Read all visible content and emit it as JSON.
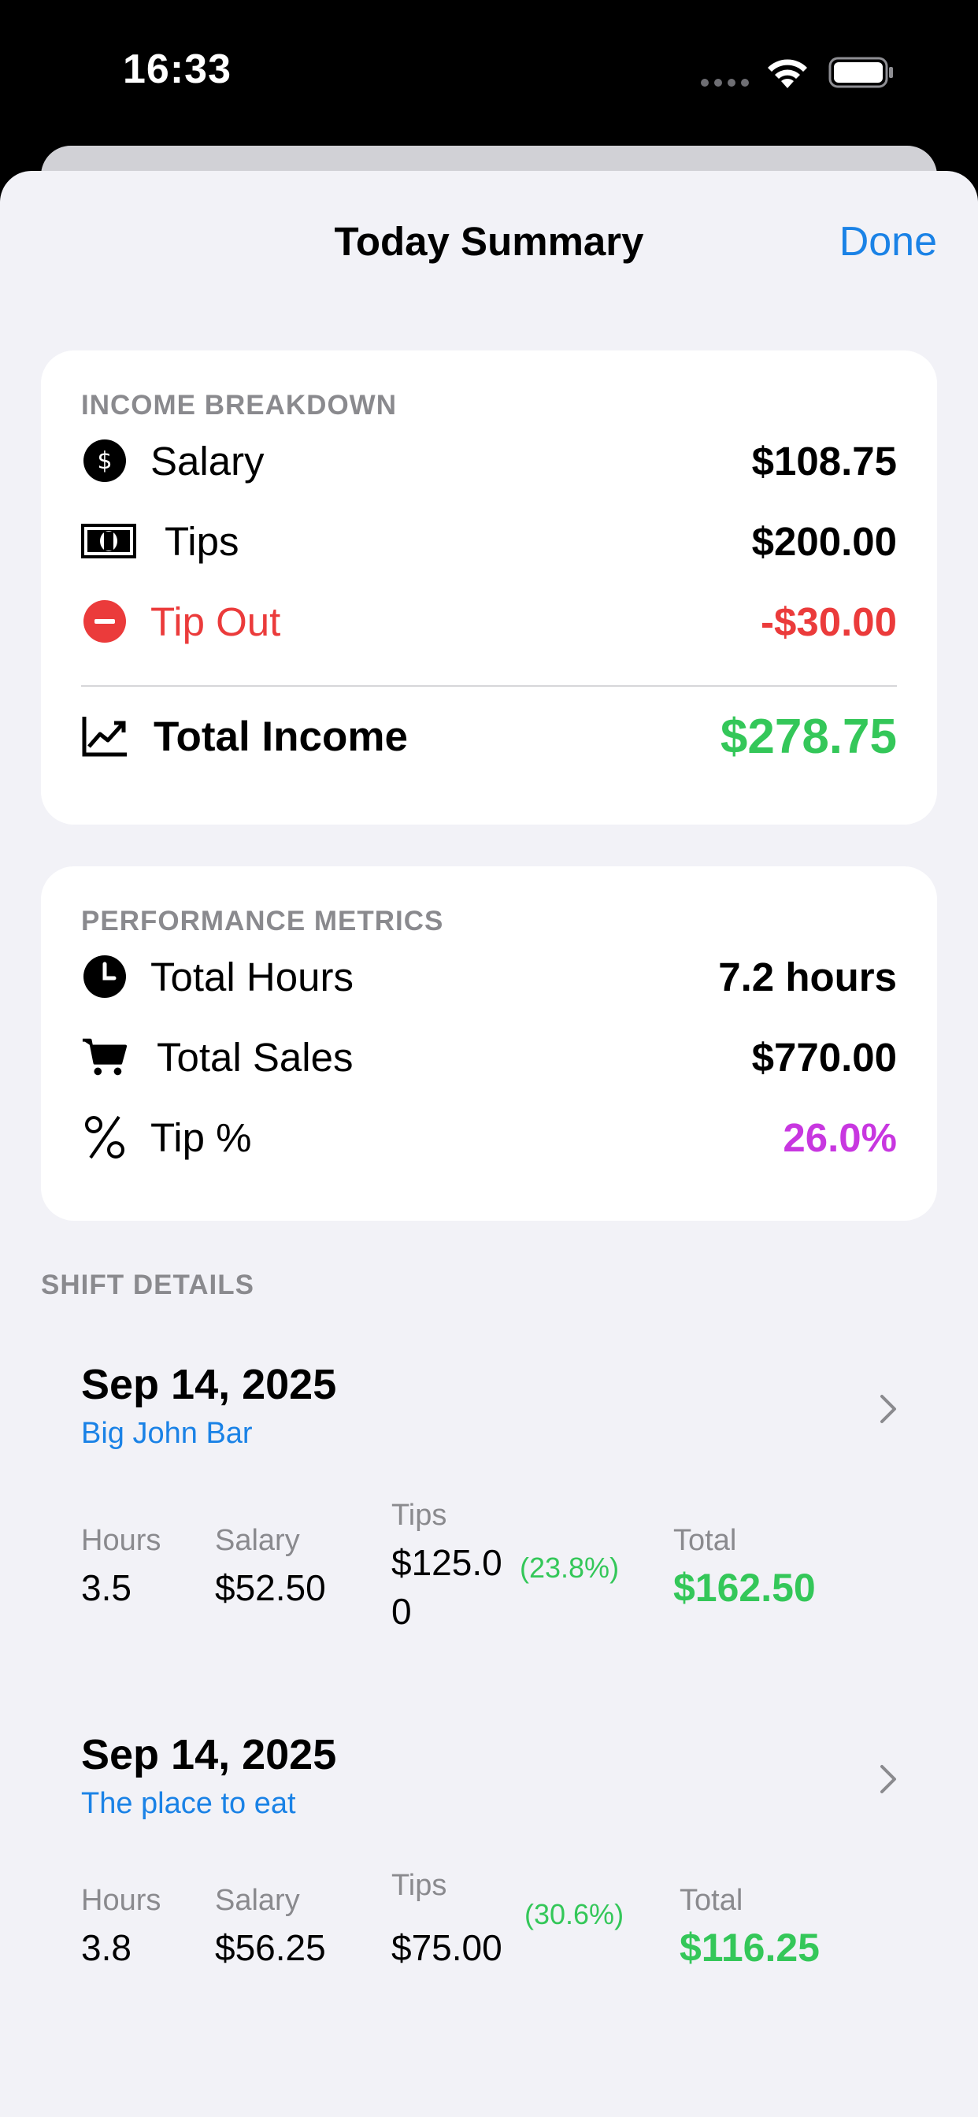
{
  "status_bar": {
    "time": "16:33"
  },
  "nav": {
    "title": "Today Summary",
    "done_label": "Done"
  },
  "income": {
    "header": "INCOME BREAKDOWN",
    "salary_label": "Salary",
    "salary_value": "$108.75",
    "tips_label": "Tips",
    "tips_value": "$200.00",
    "tipout_label": "Tip Out",
    "tipout_value": "-$30.00",
    "total_label": "Total Income",
    "total_value": "$278.75"
  },
  "metrics": {
    "header": "PERFORMANCE METRICS",
    "hours_label": "Total Hours",
    "hours_value": "7.2 hours",
    "sales_label": "Total Sales",
    "sales_value": "$770.00",
    "tippct_label": "Tip %",
    "tippct_value": "26.0%"
  },
  "shift_details": {
    "header": "SHIFT DETAILS",
    "labels": {
      "hours": "Hours",
      "salary": "Salary",
      "tips": "Tips",
      "total": "Total"
    },
    "shifts": [
      {
        "date": "Sep 14, 2025",
        "place": "Big John Bar",
        "hours": "3.5",
        "salary": "$52.50",
        "tips": "$125.00",
        "tip_pct": "(23.8%)",
        "total": "$162.50"
      },
      {
        "date": "Sep 14, 2025",
        "place": "The place to eat",
        "hours": "3.8",
        "salary": "$56.25",
        "tips": "$75.00",
        "tip_pct": "(30.6%)",
        "total": "$116.25"
      }
    ]
  },
  "colors": {
    "accent": "#1a82e6",
    "positive": "#34c759",
    "negative": "#eb3b3b",
    "tip_percent": "#c837e0",
    "background": "#f2f2f7"
  },
  "icons": [
    "dollar-circle-icon",
    "banknote-icon",
    "minus-circle-icon",
    "chart-line-icon",
    "clock-icon",
    "cart-icon",
    "percent-icon",
    "chevron-right-icon",
    "wifi-icon",
    "battery-icon"
  ]
}
